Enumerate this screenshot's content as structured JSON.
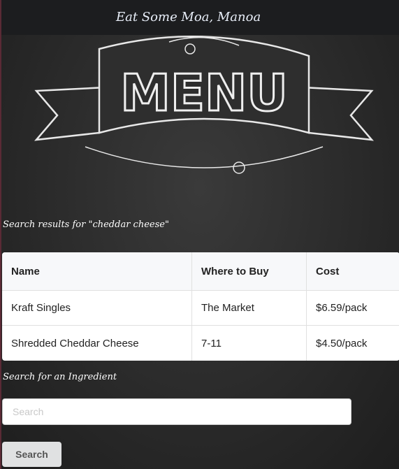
{
  "nav": {
    "brand": "Eat Some Moa, Manoa"
  },
  "banner": {
    "text": "MENU"
  },
  "results": {
    "heading": "Search results for \"cheddar cheese\"",
    "columns": [
      "Name",
      "Where to Buy",
      "Cost"
    ],
    "rows": [
      [
        "Kraft Singles",
        "The Market",
        "$6.59/pack"
      ],
      [
        "Shredded Cheddar Cheese",
        "7-11",
        "$4.50/pack"
      ]
    ]
  },
  "search": {
    "heading": "Search for an Ingredient",
    "placeholder": "Search",
    "value": "",
    "button": "Search"
  }
}
